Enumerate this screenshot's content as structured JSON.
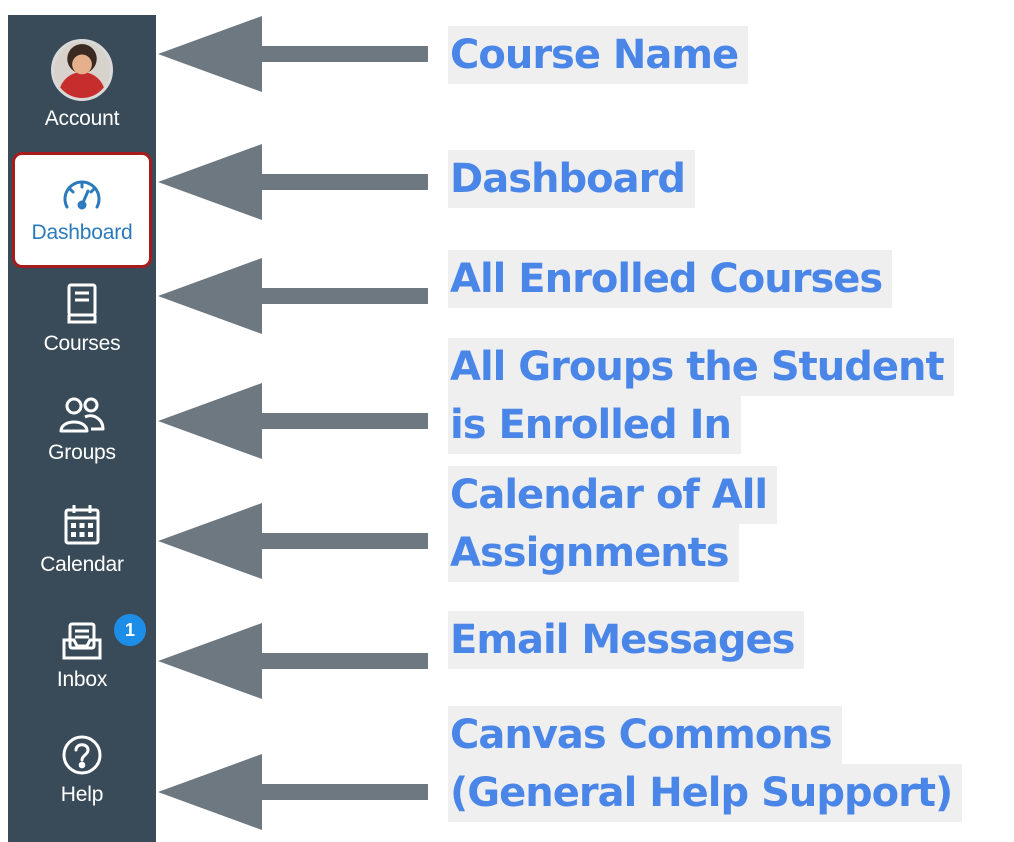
{
  "sidebar": {
    "items": [
      {
        "key": "account",
        "label": "Account"
      },
      {
        "key": "dashboard",
        "label": "Dashboard"
      },
      {
        "key": "courses",
        "label": "Courses"
      },
      {
        "key": "groups",
        "label": "Groups"
      },
      {
        "key": "calendar",
        "label": "Calendar"
      },
      {
        "key": "inbox",
        "label": "Inbox",
        "badge": "1"
      },
      {
        "key": "help",
        "label": "Help"
      }
    ],
    "colors": {
      "background": "#394b58",
      "active_text": "#2b7abc",
      "active_border": "#a61c1c",
      "badge": "#1d8ee8"
    }
  },
  "callouts": {
    "course_name": "Course Name",
    "dashboard": "Dashboard",
    "all_courses": "All Enrolled Courses",
    "groups_line1": "All Groups the Student",
    "groups_line2": "is Enrolled In",
    "calendar_line1": "Calendar of All",
    "calendar_line2": "Assignments",
    "email": "Email Messages",
    "commons_line1": "Canvas Commons",
    "commons_line2": "(General Help Support)"
  },
  "icons": [
    "avatar",
    "dashboard-gauge-icon",
    "courses-book-icon",
    "groups-people-icon",
    "calendar-icon",
    "inbox-tray-icon",
    "help-question-icon",
    "arrow-left-icon"
  ],
  "callout_color": "#4a86e8",
  "arrow_color": "#6e7880"
}
